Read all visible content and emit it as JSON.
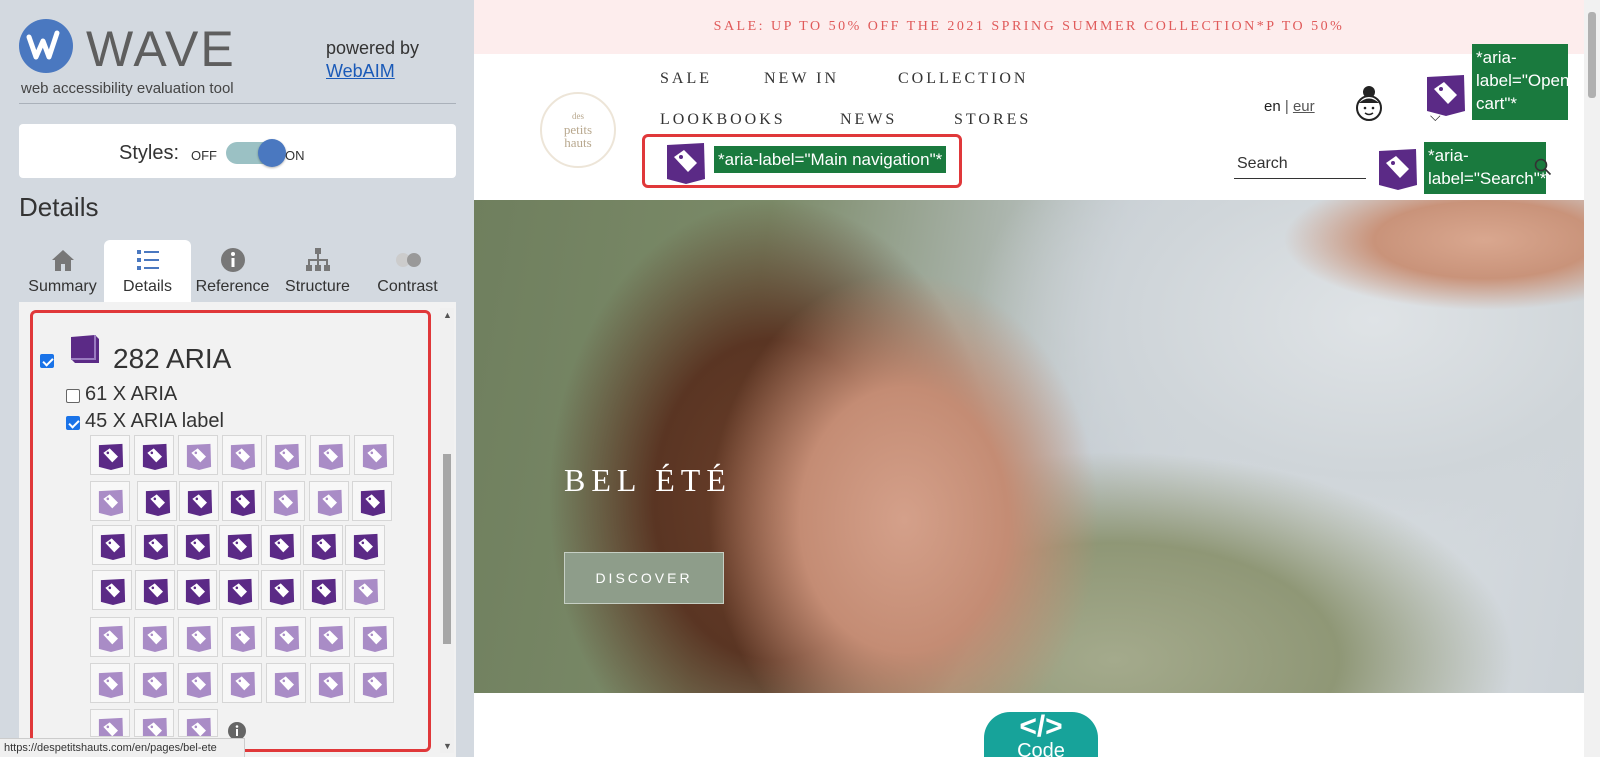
{
  "wave": {
    "title": "WAVE",
    "subtitle": "web accessibility evaluation tool",
    "powered_by": "powered by",
    "webaim_link": "WebAIM",
    "styles_label": "Styles:",
    "styles_off": "OFF",
    "styles_on": "ON",
    "styles_enabled": true,
    "details_heading": "Details",
    "tabs": [
      {
        "label": "Summary",
        "icon": "home-icon",
        "active": false
      },
      {
        "label": "Details",
        "icon": "list-icon",
        "active": true
      },
      {
        "label": "Reference",
        "icon": "info-icon",
        "active": false
      },
      {
        "label": "Structure",
        "icon": "structure-icon",
        "active": false
      },
      {
        "label": "Contrast",
        "icon": "contrast-icon",
        "active": false
      }
    ],
    "aria_group": {
      "label": "282 ARIA",
      "checked": true
    },
    "aria_items": [
      {
        "label": "61 X ARIA",
        "checked": false
      },
      {
        "label": "45 X ARIA label",
        "checked": true
      }
    ],
    "status_url": "https://despetitshauts.com/en/pages/bel-ete"
  },
  "site": {
    "promo": "SALE: UP TO 50% OFF THE 2021 SPRING SUMMER COLLECTION*P TO 50%",
    "logo_text": [
      "des",
      "petits",
      "hauts"
    ],
    "nav": [
      "SALE",
      "NEW IN",
      "COLLECTION",
      "LOOKBOOKS",
      "NEWS",
      "STORES"
    ],
    "lang": "en",
    "lang_sep": "|",
    "currency": "eur",
    "search_placeholder": "Search",
    "aria_main_nav": "*aria-label=\"Main navigation\"*",
    "aria_open_cart": "*aria-label=\"Open cart\"*",
    "aria_search": "*aria-label=\"Search\"*",
    "hero_title": "BEL ÉTÉ",
    "hero_button": "DISCOVER",
    "code_button_symbol": "</>",
    "code_button_label": "Code"
  },
  "colors": {
    "wave_blue": "#4a78c0",
    "aria_purple": "#5b2a86",
    "aria_green": "#1a7a3e",
    "highlight_red": "#e0383a",
    "code_teal": "#17a39a"
  }
}
